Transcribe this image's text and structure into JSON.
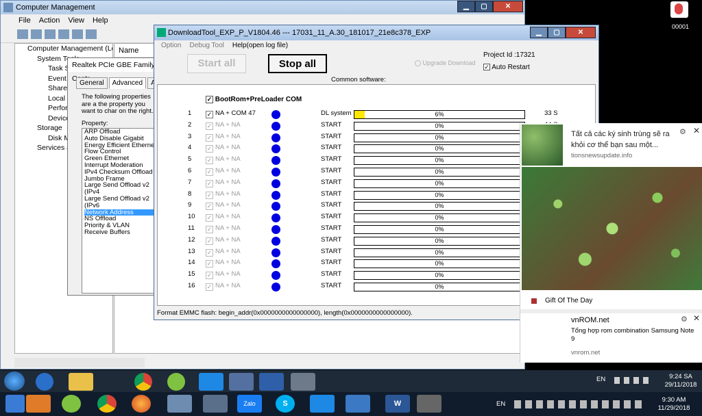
{
  "computer_management": {
    "title": "Computer Management",
    "menu": [
      "File",
      "Action",
      "View",
      "Help"
    ],
    "tree": [
      "Computer Management (Local",
      "System Tools",
      "Task Sc",
      "Event V",
      "Shared",
      "Local U",
      "Perform",
      "Device I",
      "Storage",
      "Disk Ma",
      "Services and"
    ],
    "column_name": "Name"
  },
  "realtek": {
    "title": "Realtek PCIe GBE Family Contr",
    "tabs": [
      "General",
      "Advanced",
      "About"
    ],
    "description": "The following properties are a the property you want to char on the right.",
    "property_label": "Property:",
    "properties": [
      "ARP Offload",
      "Auto Disable Gigabit",
      "Energy Efficient Ethernet",
      "Flow Control",
      "Green Ethernet",
      "Interrupt Moderation",
      "IPv4 Checksum Offload",
      "Jumbo Frame",
      "Large Send Offload v2 (IPv4",
      "Large Send Offload v2 (IPv6",
      "Network Address",
      "NS Offload",
      "Priority & VLAN",
      "Receive Buffers"
    ],
    "selected": "Network Address"
  },
  "download_tool": {
    "title": "DownloadTool_EXP_P_V1804.46 --- 17031_11_A.30_181017_21e8c378_EXP",
    "menu": [
      "Option",
      "Debug Tool",
      "Help(open log file)"
    ],
    "start_all": "Start all",
    "stop_all": "Stop all",
    "upgrade_download": "Upgrade Download",
    "project_id": "Project Id :17321",
    "auto_restart": "Auto Restart",
    "common_software": "Common software:",
    "bootrom_label": "BootRom+PreLoader COM",
    "rows": [
      {
        "num": "1",
        "com": "NA + COM 47",
        "status": "DL system",
        "pct": "6%",
        "progress": 0.06,
        "time": "33 S",
        "active": true
      },
      {
        "num": "2",
        "com": "NA + NA",
        "status": "START",
        "pct": "0%",
        "progress": 0,
        "time": "44 S",
        "active": false
      },
      {
        "num": "3",
        "com": "NA + NA",
        "status": "START",
        "pct": "0%",
        "progress": 0,
        "time": "",
        "active": false
      },
      {
        "num": "4",
        "com": "NA + NA",
        "status": "START",
        "pct": "0%",
        "progress": 0,
        "time": "",
        "active": false
      },
      {
        "num": "5",
        "com": "NA + NA",
        "status": "START",
        "pct": "0%",
        "progress": 0,
        "time": "",
        "active": false
      },
      {
        "num": "6",
        "com": "NA + NA",
        "status": "START",
        "pct": "0%",
        "progress": 0,
        "time": "",
        "active": false
      },
      {
        "num": "7",
        "com": "NA + NA",
        "status": "START",
        "pct": "0%",
        "progress": 0,
        "time": "",
        "active": false
      },
      {
        "num": "8",
        "com": "NA + NA",
        "status": "START",
        "pct": "0%",
        "progress": 0,
        "time": "",
        "active": false
      },
      {
        "num": "9",
        "com": "NA + NA",
        "status": "START",
        "pct": "0%",
        "progress": 0,
        "time": "",
        "active": false
      },
      {
        "num": "10",
        "com": "NA + NA",
        "status": "START",
        "pct": "0%",
        "progress": 0,
        "time": "",
        "active": false
      },
      {
        "num": "11",
        "com": "NA + NA",
        "status": "START",
        "pct": "0%",
        "progress": 0,
        "time": "",
        "active": false
      },
      {
        "num": "12",
        "com": "NA + NA",
        "status": "START",
        "pct": "0%",
        "progress": 0,
        "time": "",
        "active": false
      },
      {
        "num": "13",
        "com": "NA + NA",
        "status": "START",
        "pct": "0%",
        "progress": 0,
        "time": "",
        "active": false
      },
      {
        "num": "14",
        "com": "NA + NA",
        "status": "START",
        "pct": "0%",
        "progress": 0,
        "time": "",
        "active": false
      },
      {
        "num": "15",
        "com": "NA + NA",
        "status": "START",
        "pct": "0%",
        "progress": 0,
        "time": "",
        "active": false
      },
      {
        "num": "16",
        "com": "NA + NA",
        "status": "START",
        "pct": "0%",
        "progress": 0,
        "time": "",
        "active": false
      }
    ],
    "status_bar": "Format EMMC flash:  begin_addr(0x0000000000000000), length(0x0000000000000000)."
  },
  "ad": {
    "headline": "Tất cả các ký sinh trùng sẽ ra khỏi cơ thể bạn sau một...",
    "source": "tionsnewsupdate.info",
    "gift": "Gift Of The Day",
    "title2": "vnROM.net",
    "desc2": "Tổng hợp rom combination Samsung Note 9",
    "source2": "vnrom.net"
  },
  "desktop": {
    "user_label": "00001"
  },
  "remote_tray": {
    "lang": "EN",
    "time": "9:24 SA",
    "date": "29/11/2018"
  },
  "local_tray": {
    "lang": "EN",
    "time": "9:30 AM",
    "date": "11/29/2018"
  },
  "colors": {
    "progress_fill": "#ffe800",
    "status_dot": "#0000e0",
    "selection": "#3399ff"
  }
}
